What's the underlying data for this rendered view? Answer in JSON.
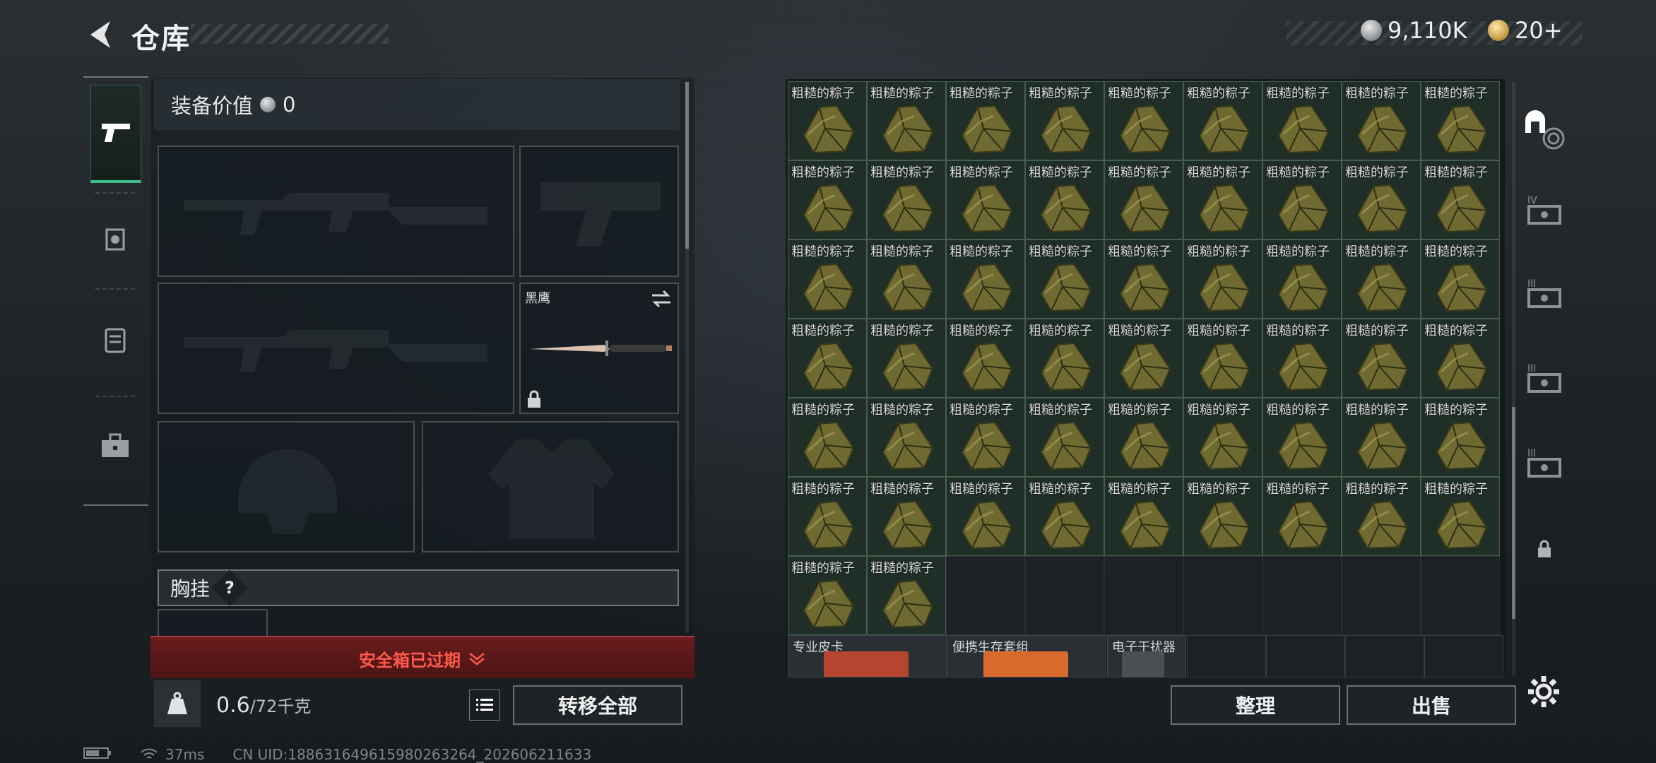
{
  "header": {
    "title": "仓库",
    "currency_silver": "9,110K",
    "currency_gold": "20+"
  },
  "tabs": [
    {
      "name": "weapons",
      "active": true
    },
    {
      "name": "helmet",
      "active": false
    },
    {
      "name": "backpack",
      "active": false
    },
    {
      "name": "toolbox",
      "active": false
    }
  ],
  "equipment": {
    "value_label": "装备价值",
    "value": "0",
    "knife_name": "黑鹰",
    "vest_label": "胸挂",
    "vest_help": "?",
    "safe_box_status": "安全箱已过期",
    "weight_current": "0.6",
    "weight_max": "/72千克",
    "transfer_all": "转移全部"
  },
  "storage": {
    "item_label": "粗糙的粽子",
    "item_count": 56,
    "columns": 9,
    "bottom_items": [
      {
        "label": "专业皮卡"
      },
      {
        "label": "便携生存套组"
      },
      {
        "label": "电子干扰器"
      }
    ],
    "organize": "整理",
    "sell": "出售"
  },
  "side_icons": [
    "home-hq-icon",
    "tier4-case-icon",
    "tier3-case-icon",
    "tier3-case-icon",
    "tier3-case-icon",
    "lock-icon"
  ],
  "status": {
    "ping": "37ms",
    "uid": "CN UID:18863164961598026326​4_202606211633"
  },
  "colors": {
    "accent_green": "#3cc08a",
    "safe_red": "#ff5a4a",
    "item_bg": "#1f2f28"
  }
}
